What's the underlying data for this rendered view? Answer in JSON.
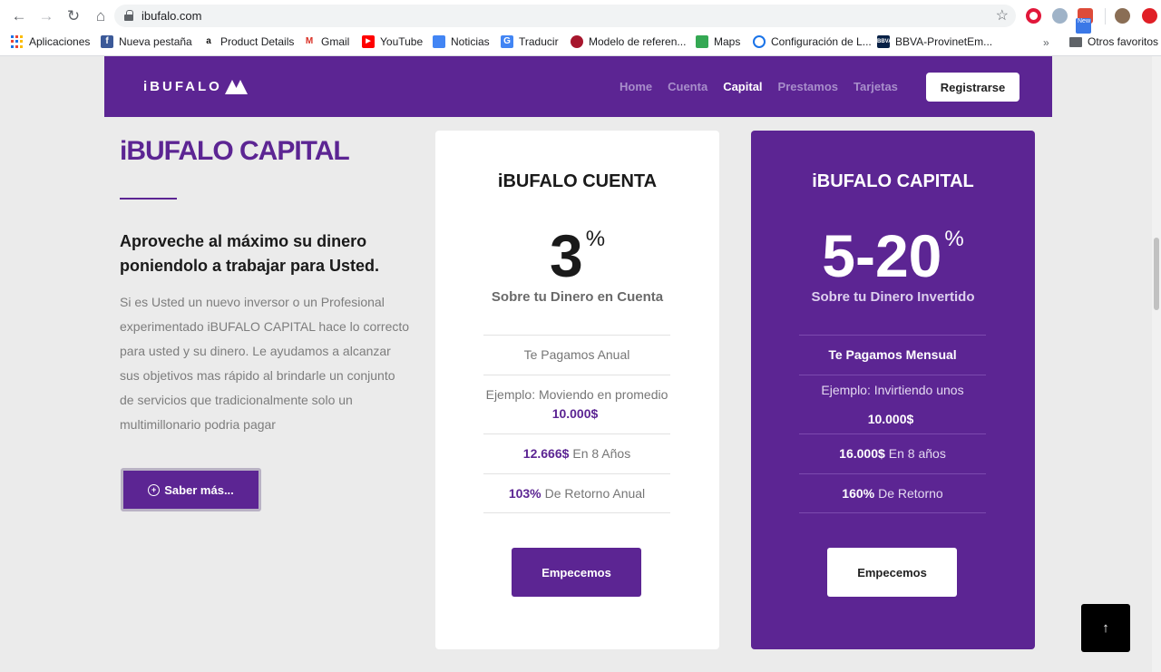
{
  "browser": {
    "url": "ibufalo.com",
    "bookmarks": [
      {
        "label": "Aplicaciones",
        "icon": "apps-icon"
      },
      {
        "label": "Nueva pestaña",
        "icon": "facebook-icon"
      },
      {
        "label": "Product Details",
        "icon": "amazon-icon"
      },
      {
        "label": "Gmail",
        "icon": "gmail-icon"
      },
      {
        "label": "YouTube",
        "icon": "youtube-icon"
      },
      {
        "label": "Noticias",
        "icon": "news-icon"
      },
      {
        "label": "Traducir",
        "icon": "translate-icon"
      },
      {
        "label": "Modelo de referen...",
        "icon": "bookmark-icon"
      },
      {
        "label": "Maps",
        "icon": "maps-icon"
      },
      {
        "label": "Configuración de L...",
        "icon": "settings-icon"
      },
      {
        "label": "BBVA-ProvinetEm...",
        "icon": "bbva-icon"
      }
    ],
    "more_bookmarks": "»",
    "other_favorites": "Otros favoritos",
    "new_badge": "New"
  },
  "header": {
    "logo_text": "iBUFALO",
    "nav": [
      {
        "label": "Home",
        "active": false
      },
      {
        "label": "Cuenta",
        "active": false
      },
      {
        "label": "Capital",
        "active": true
      },
      {
        "label": "Prestamos",
        "active": false
      },
      {
        "label": "Tarjetas",
        "active": false
      }
    ],
    "register_label": "Registrarse"
  },
  "intro": {
    "title": "iBUFALO CAPITAL",
    "subtitle": "Aproveche al máximo su dinero poniendolo a trabajar para Usted.",
    "body": "Si es Usted un nuevo inversor o un Profesional experimentado iBUFALO CAPITAL hace lo correcto para usted y su dinero. Le ayudamos a alcanzar sus objetivos mas rápido al brindarle un conjunto de servicios que tradicionalmente solo un multimillonario podria pagar",
    "more_label": "Saber más...",
    "more_icon": "plus-circle-icon"
  },
  "cards": {
    "cuenta": {
      "title": "iBUFALO CUENTA",
      "rate": "3",
      "percent": "%",
      "sub": "Sobre tu Dinero en Cuenta",
      "row1": "Te Pagamos Anual",
      "row2_text": "Ejemplo: Moviendo en promedio",
      "row2_value": "10.000$",
      "row3_value": "12.666$",
      "row3_text": "En 8 Años",
      "row4_value": "103%",
      "row4_text": "De Retorno Anual",
      "button": "Empecemos"
    },
    "capital": {
      "title": "iBUFALO CAPITAL",
      "rate": "5-20",
      "percent": "%",
      "sub": "Sobre tu Dinero Invertido",
      "row1": "Te Pagamos Mensual",
      "row2_text": "Ejemplo: Invirtiendo unos",
      "row2_value": "10.000$",
      "row3_value": "16.000$",
      "row3_text": "En 8 años",
      "row4_value": "160%",
      "row4_text": "De Retorno",
      "button": "Empecemos"
    }
  },
  "back_to_top": "↑",
  "colors": {
    "brand": "#5c2593",
    "page_bg": "#ebebeb"
  }
}
